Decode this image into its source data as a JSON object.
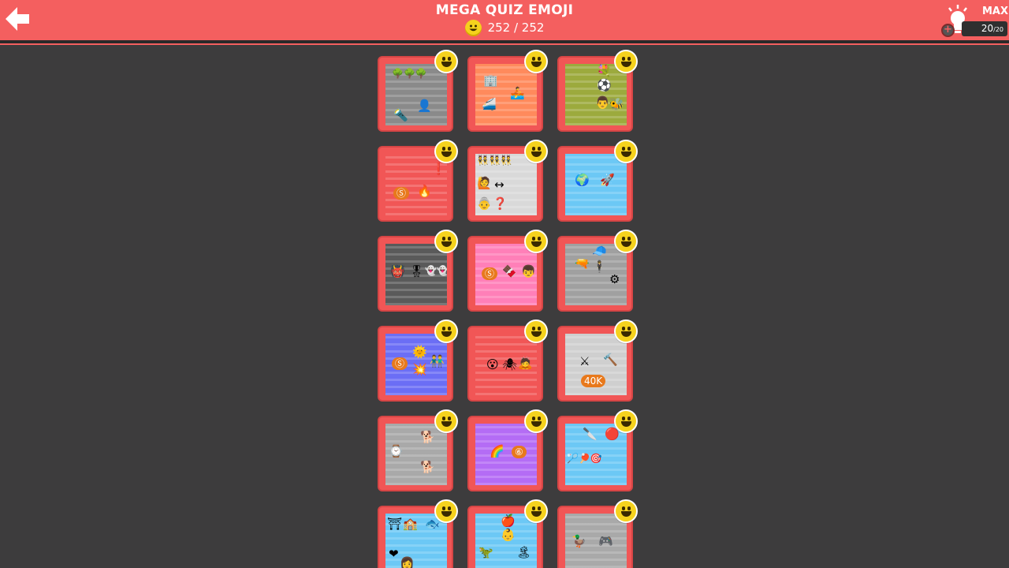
{
  "header": {
    "title": "MEGA QUIZ EMOJI",
    "score": "252 / 252",
    "hint_label": "MAX",
    "hint_count": "20",
    "hint_total": "/20",
    "plus": "+"
  },
  "colors": {
    "accent": "#f45f5f",
    "background": "#3d3c3d",
    "coin": "#f5d21d"
  },
  "levels": [
    {
      "bg": "#8a8a8a",
      "emoji": [
        "🌳🌳🌳",
        "🔦",
        "👤"
      ]
    },
    {
      "bg": "#ff8a5c",
      "emoji": [
        "🏢",
        "🚄",
        "🚣"
      ]
    },
    {
      "bg": "#9caa3d",
      "emoji": [
        "💐",
        "⚽",
        "👨",
        "🐝"
      ]
    },
    {
      "bg": "#f15656",
      "emoji": [
        "Ⓢ",
        "🔥",
        "❗"
      ]
    },
    {
      "bg": "#d9d9d9",
      "emoji": [
        "👯👯👯",
        "🙋",
        "↔",
        "👵",
        "❓"
      ]
    },
    {
      "bg": "#6cc8f5",
      "emoji": [
        "🌍",
        "🚀"
      ]
    },
    {
      "bg": "#5a5a5a",
      "emoji": [
        "👹",
        "🎖",
        "👻👻"
      ]
    },
    {
      "bg": "#ff7fb8",
      "emoji": [
        "Ⓢ",
        "🍫",
        "👦"
      ]
    },
    {
      "bg": "#a0a0a0",
      "emoji": [
        "🧢",
        "🔫",
        "🕴",
        "⚙"
      ]
    },
    {
      "bg": "#6b6ef5",
      "emoji": [
        "Ⓢ",
        "🌞",
        "💥",
        "👬"
      ]
    },
    {
      "bg": "#f15656",
      "emoji": [
        "😮",
        "🕷",
        "🙇"
      ]
    },
    {
      "bg": "#cfcfcf",
      "emoji": [
        "⚔",
        "🔨",
        "40K"
      ]
    },
    {
      "bg": "#a9a9a9",
      "emoji": [
        "⌚",
        "🐕",
        "🐕"
      ]
    },
    {
      "bg": "#b46cf5",
      "emoji": [
        "🌈",
        "⑥"
      ]
    },
    {
      "bg": "#6cc8f5",
      "emoji": [
        "🔪",
        "🔴",
        "🏸🏓🎯"
      ]
    },
    {
      "bg": "#6cc8f5",
      "emoji": [
        "⛩",
        "🏫",
        "🐟",
        "❤",
        "👩"
      ]
    },
    {
      "bg": "#6cc8f5",
      "emoji": [
        "🍎",
        "👶",
        "🦖",
        "🏝"
      ]
    },
    {
      "bg": "#a9a9a9",
      "emoji": [
        "🦆",
        "🎮"
      ]
    }
  ]
}
